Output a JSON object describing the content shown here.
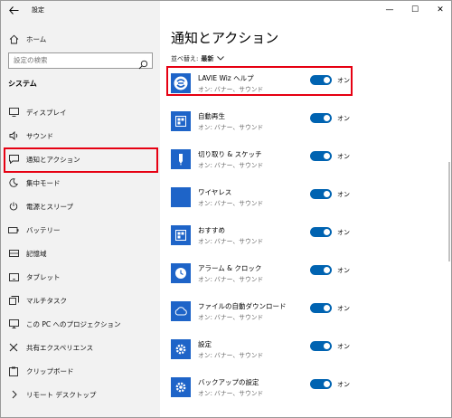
{
  "window": {
    "title": "設定",
    "controls": {
      "minimize": "—",
      "maximize": "☐",
      "close": "✕"
    }
  },
  "sidebar": {
    "home_label": "ホーム",
    "search_placeholder": "設定の検索",
    "section_heading": "システム",
    "items": [
      {
        "label": "ディスプレイ",
        "icon": "display-icon"
      },
      {
        "label": "サウンド",
        "icon": "speaker-icon"
      },
      {
        "label": "通知とアクション",
        "icon": "notification-icon",
        "selected": true
      },
      {
        "label": "集中モード",
        "icon": "moon-icon"
      },
      {
        "label": "電源とスリープ",
        "icon": "power-icon"
      },
      {
        "label": "バッテリー",
        "icon": "battery-icon"
      },
      {
        "label": "記憶域",
        "icon": "storage-icon"
      },
      {
        "label": "タブレット",
        "icon": "tablet-icon"
      },
      {
        "label": "マルチタスク",
        "icon": "multitask-icon"
      },
      {
        "label": "この PC へのプロジェクション",
        "icon": "projection-icon"
      },
      {
        "label": "共有エクスペリエンス",
        "icon": "shared-icon"
      },
      {
        "label": "クリップボード",
        "icon": "clipboard-icon"
      },
      {
        "label": "リモート デスクトップ",
        "icon": "remote-desktop-icon"
      }
    ]
  },
  "main": {
    "title": "通知とアクション",
    "sort_label": "並べ替え:",
    "sort_value": "最新",
    "apps": [
      {
        "name": "LAVIE Wiz ヘルプ",
        "sub": "オン: バナー、サウンド",
        "toggle": "オン",
        "icon": "lavie-help-icon"
      },
      {
        "name": "自動再生",
        "sub": "オン: バナー、サウンド",
        "toggle": "オン",
        "icon": "autoplay-icon"
      },
      {
        "name": "切り取り & スケッチ",
        "sub": "オン: バナー、サウンド",
        "toggle": "オン",
        "icon": "snip-sketch-icon"
      },
      {
        "name": "ワイヤレス",
        "sub": "オン: バナー、サウンド",
        "toggle": "オン",
        "icon": "wireless-icon"
      },
      {
        "name": "おすすめ",
        "sub": "オン: バナー、サウンド",
        "toggle": "オン",
        "icon": "suggested-icon"
      },
      {
        "name": "アラーム & クロック",
        "sub": "オン: バナー、サウンド",
        "toggle": "オン",
        "icon": "alarm-clock-icon"
      },
      {
        "name": "ファイルの自動ダウンロード",
        "sub": "オン: バナー、サウンド",
        "toggle": "オン",
        "icon": "cloud-icon"
      },
      {
        "name": "設定",
        "sub": "オン: バナー、サウンド",
        "toggle": "オン",
        "icon": "gear-icon"
      },
      {
        "name": "バックアップの設定",
        "sub": "オン: バナー、サウンド",
        "toggle": "オン",
        "icon": "gear-icon"
      }
    ]
  },
  "colors": {
    "accent": "#0063b1",
    "tile": "#1e64c8",
    "highlight": "#e60012",
    "sidebar_bg": "#f2f2f2"
  }
}
